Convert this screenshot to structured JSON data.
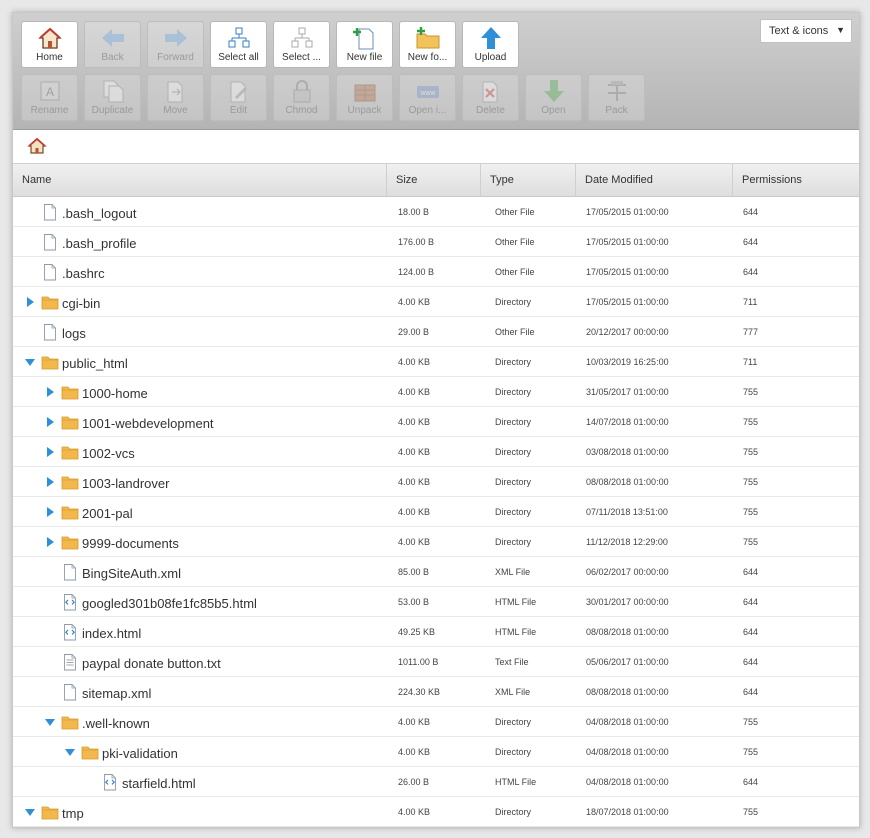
{
  "toolbar": {
    "row1": [
      {
        "id": "home",
        "label": "Home",
        "icon": "home-icon",
        "enabled": true
      },
      {
        "id": "back",
        "label": "Back",
        "icon": "back-arrow-icon",
        "enabled": false
      },
      {
        "id": "forward",
        "label": "Forward",
        "icon": "forward-arrow-icon",
        "enabled": false
      },
      {
        "id": "select-all",
        "label": "Select all",
        "icon": "select-all-icon",
        "enabled": true
      },
      {
        "id": "select-none",
        "label": "Select ...",
        "icon": "select-none-icon",
        "enabled": true
      },
      {
        "id": "new-file",
        "label": "New file",
        "icon": "new-file-icon",
        "enabled": true
      },
      {
        "id": "new-folder",
        "label": "New fo...",
        "icon": "new-folder-icon",
        "enabled": true
      },
      {
        "id": "upload",
        "label": "Upload",
        "icon": "upload-icon",
        "enabled": true
      }
    ],
    "row2": [
      {
        "id": "rename",
        "label": "Rename",
        "icon": "rename-icon",
        "enabled": false
      },
      {
        "id": "duplicate",
        "label": "Duplicate",
        "icon": "duplicate-icon",
        "enabled": false
      },
      {
        "id": "move",
        "label": "Move",
        "icon": "move-icon",
        "enabled": false
      },
      {
        "id": "edit",
        "label": "Edit",
        "icon": "edit-icon",
        "enabled": false
      },
      {
        "id": "chmod",
        "label": "Chmod",
        "icon": "lock-icon",
        "enabled": false
      },
      {
        "id": "unpack",
        "label": "Unpack",
        "icon": "unpack-icon",
        "enabled": false
      },
      {
        "id": "open-in",
        "label": "Open i...",
        "icon": "open-in-icon",
        "enabled": false
      },
      {
        "id": "delete",
        "label": "Delete",
        "icon": "delete-icon",
        "enabled": false
      },
      {
        "id": "open",
        "label": "Open",
        "icon": "download-arrow-icon",
        "enabled": false
      },
      {
        "id": "pack",
        "label": "Pack",
        "icon": "pack-icon",
        "enabled": false
      }
    ],
    "view_select": "Text & icons"
  },
  "columns": {
    "name": "Name",
    "size": "Size",
    "type": "Type",
    "date": "Date Modified",
    "perm": "Permissions"
  },
  "rows": [
    {
      "name": ".bash_logout",
      "size": "18.00 B",
      "type": "Other File",
      "date": "17/05/2015 01:00:00",
      "perm": "644",
      "depth": 0,
      "kind": "file",
      "toggle": "none"
    },
    {
      "name": ".bash_profile",
      "size": "176.00 B",
      "type": "Other File",
      "date": "17/05/2015 01:00:00",
      "perm": "644",
      "depth": 0,
      "kind": "file",
      "toggle": "none"
    },
    {
      "name": ".bashrc",
      "size": "124.00 B",
      "type": "Other File",
      "date": "17/05/2015 01:00:00",
      "perm": "644",
      "depth": 0,
      "kind": "file",
      "toggle": "none"
    },
    {
      "name": "cgi-bin",
      "size": "4.00 KB",
      "type": "Directory",
      "date": "17/05/2015 01:00:00",
      "perm": "711",
      "depth": 0,
      "kind": "folder",
      "toggle": "collapsed"
    },
    {
      "name": "logs",
      "size": "29.00 B",
      "type": "Other File",
      "date": "20/12/2017 00:00:00",
      "perm": "777",
      "depth": 0,
      "kind": "file",
      "toggle": "none"
    },
    {
      "name": "public_html",
      "size": "4.00 KB",
      "type": "Directory",
      "date": "10/03/2019 16:25:00",
      "perm": "711",
      "depth": 0,
      "kind": "folder",
      "toggle": "expanded"
    },
    {
      "name": "1000-home",
      "size": "4.00 KB",
      "type": "Directory",
      "date": "31/05/2017 01:00:00",
      "perm": "755",
      "depth": 1,
      "kind": "folder",
      "toggle": "collapsed"
    },
    {
      "name": "1001-webdevelopment",
      "size": "4.00 KB",
      "type": "Directory",
      "date": "14/07/2018 01:00:00",
      "perm": "755",
      "depth": 1,
      "kind": "folder",
      "toggle": "collapsed"
    },
    {
      "name": "1002-vcs",
      "size": "4.00 KB",
      "type": "Directory",
      "date": "03/08/2018 01:00:00",
      "perm": "755",
      "depth": 1,
      "kind": "folder",
      "toggle": "collapsed"
    },
    {
      "name": "1003-landrover",
      "size": "4.00 KB",
      "type": "Directory",
      "date": "08/08/2018 01:00:00",
      "perm": "755",
      "depth": 1,
      "kind": "folder",
      "toggle": "collapsed"
    },
    {
      "name": "2001-pal",
      "size": "4.00 KB",
      "type": "Directory",
      "date": "07/11/2018 13:51:00",
      "perm": "755",
      "depth": 1,
      "kind": "folder",
      "toggle": "collapsed"
    },
    {
      "name": "9999-documents",
      "size": "4.00 KB",
      "type": "Directory",
      "date": "11/12/2018 12:29:00",
      "perm": "755",
      "depth": 1,
      "kind": "folder",
      "toggle": "collapsed"
    },
    {
      "name": "BingSiteAuth.xml",
      "size": "85.00 B",
      "type": "XML File",
      "date": "06/02/2017 00:00:00",
      "perm": "644",
      "depth": 1,
      "kind": "file",
      "toggle": "none"
    },
    {
      "name": "googled301b08fe1fc85b5.html",
      "size": "53.00 B",
      "type": "HTML File",
      "date": "30/01/2017 00:00:00",
      "perm": "644",
      "depth": 1,
      "kind": "html",
      "toggle": "none"
    },
    {
      "name": "index.html",
      "size": "49.25 KB",
      "type": "HTML File",
      "date": "08/08/2018 01:00:00",
      "perm": "644",
      "depth": 1,
      "kind": "html",
      "toggle": "none"
    },
    {
      "name": "paypal donate button.txt",
      "size": "1011.00 B",
      "type": "Text File",
      "date": "05/06/2017 01:00:00",
      "perm": "644",
      "depth": 1,
      "kind": "text",
      "toggle": "none"
    },
    {
      "name": "sitemap.xml",
      "size": "224.30 KB",
      "type": "XML File",
      "date": "08/08/2018 01:00:00",
      "perm": "644",
      "depth": 1,
      "kind": "file",
      "toggle": "none"
    },
    {
      "name": ".well-known",
      "size": "4.00 KB",
      "type": "Directory",
      "date": "04/08/2018 01:00:00",
      "perm": "755",
      "depth": 1,
      "kind": "folder",
      "toggle": "expanded"
    },
    {
      "name": "pki-validation",
      "size": "4.00 KB",
      "type": "Directory",
      "date": "04/08/2018 01:00:00",
      "perm": "755",
      "depth": 2,
      "kind": "folder",
      "toggle": "expanded"
    },
    {
      "name": "starfield.html",
      "size": "26.00 B",
      "type": "HTML File",
      "date": "04/08/2018 01:00:00",
      "perm": "644",
      "depth": 3,
      "kind": "html",
      "toggle": "none"
    },
    {
      "name": "tmp",
      "size": "4.00 KB",
      "type": "Directory",
      "date": "18/07/2018 01:00:00",
      "perm": "755",
      "depth": 0,
      "kind": "folder",
      "toggle": "expanded"
    }
  ],
  "colors": {
    "toggle": "#2f8fd8",
    "folder": "#f2b84b",
    "folder_dark": "#d99a2b"
  }
}
